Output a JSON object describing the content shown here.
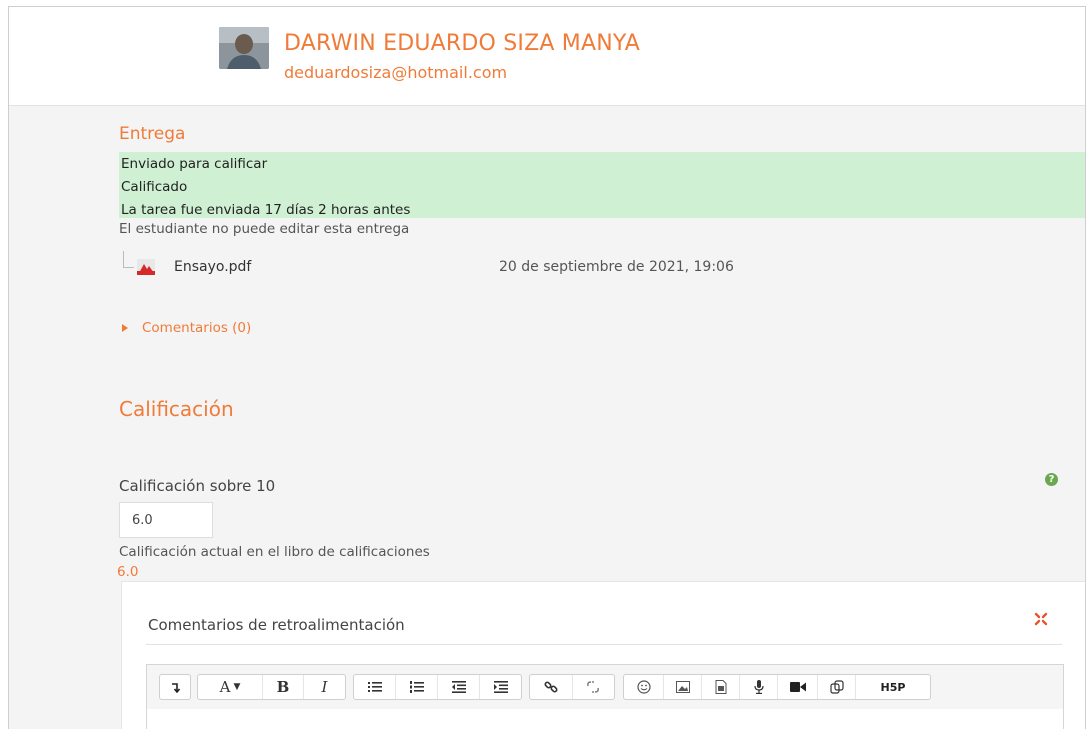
{
  "user": {
    "name": "DARWIN EDUARDO SIZA MANYA",
    "email": "deduardosiza@hotmail.com"
  },
  "submission": {
    "title": "Entrega",
    "status_lines": [
      "Enviado para calificar",
      "Calificado",
      "La tarea fue enviada 17 días 2 horas antes"
    ],
    "edit_note": "El estudiante no puede editar esta entrega",
    "file": {
      "name": "Ensayo.pdf",
      "date": "20 de septiembre de 2021, 19:06"
    },
    "comments_label": "Comentarios (0)"
  },
  "grading": {
    "title": "Calificación",
    "grade_label": "Calificación sobre 10",
    "grade_value": "6.0",
    "current_label": "Calificación actual en el libro de calificaciones",
    "current_value": "6.0"
  },
  "feedback": {
    "title": "Comentarios de retroalimentación",
    "toolbar_icons": [
      "collapse-toolbar-icon",
      "font-style-icon",
      "bold-icon",
      "italic-icon",
      "unordered-list-icon",
      "ordered-list-icon",
      "outdent-icon",
      "indent-icon",
      "link-icon",
      "unlink-icon",
      "emoticon-icon",
      "image-icon",
      "media-icon",
      "record-audio-icon",
      "record-video-icon",
      "manage-files-icon",
      "h5p-icon"
    ],
    "h5p_label": "H5P"
  },
  "colors": {
    "accent": "#f07b39",
    "status_background": "#d0f0d3",
    "help_icon": "#6aa84f"
  }
}
